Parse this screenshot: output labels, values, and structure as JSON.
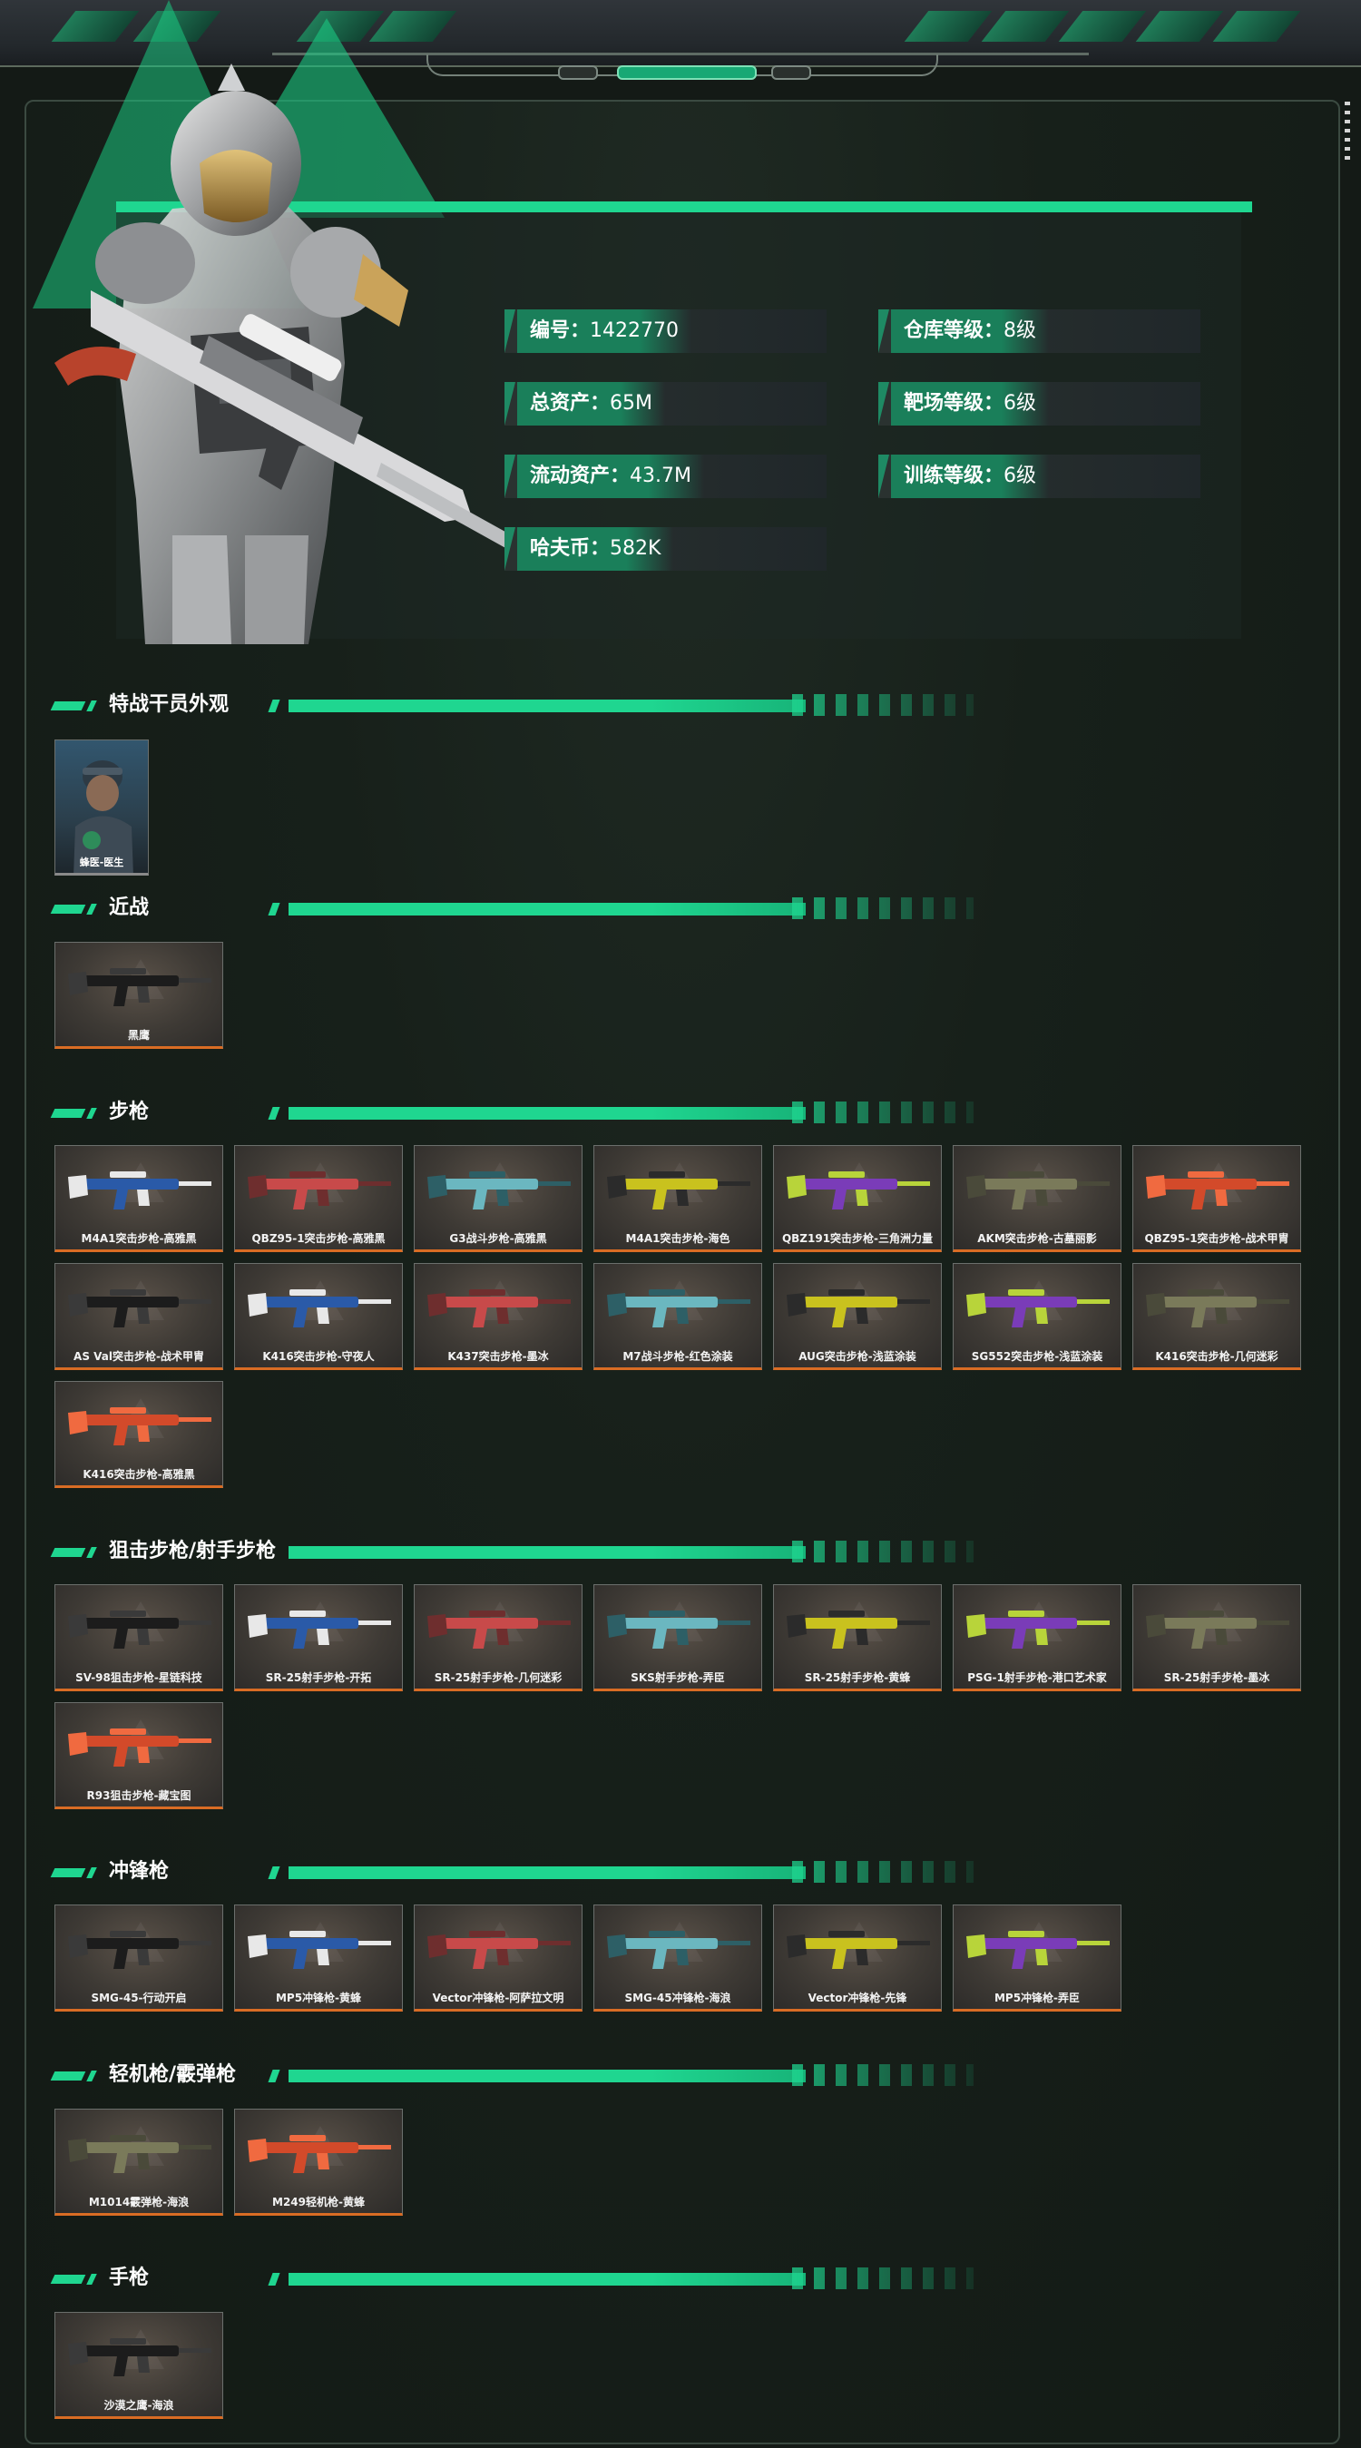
{
  "player": {
    "id_label": "编号：",
    "id_value": "1422770",
    "total_assets_label": "总资产：",
    "total_assets_value": "65M",
    "liquid_assets_label": "流动资产：",
    "liquid_assets_value": "43.7M",
    "havoc_coin_label": "哈夫币：",
    "havoc_coin_value": "582K",
    "warehouse_level_label": "仓库等级：",
    "warehouse_level_value": "8级",
    "range_level_label": "靶场等级：",
    "range_level_value": "6级",
    "training_level_label": "训练等级：",
    "training_level_value": "6级"
  },
  "sections": {
    "operator": {
      "title": "特战干员外观",
      "items": [
        "蜂医-医生"
      ]
    },
    "melee": {
      "title": "近战",
      "items": [
        "黑鹰"
      ]
    },
    "rifle": {
      "title": "步枪",
      "items": [
        "M4A1突击步枪-高雅黑",
        "QBZ95-1突击步枪-高雅黑",
        "G3战斗步枪-高雅黑",
        "M4A1突击步枪-海色",
        "QBZ191突击步枪-三角洲力量",
        "AKM突击步枪-古墓丽影",
        "QBZ95-1突击步枪-战术甲胄",
        "AS Val突击步枪-战术甲胄",
        "K416突击步枪-守夜人",
        "K437突击步枪-墨冰",
        "M7战斗步枪-红色涂装",
        "AUG突击步枪-浅蓝涂装",
        "SG552突击步枪-浅蓝涂装",
        "K416突击步枪-几何迷彩",
        "K416突击步枪-高雅黑"
      ]
    },
    "sniper": {
      "title": "狙击步枪/射手步枪",
      "items": [
        "SV-98狙击步枪-星链科技",
        "SR-25射手步枪-开拓",
        "SR-25射手步枪-几何迷彩",
        "SKS射手步枪-弄臣",
        "SR-25射手步枪-黄蜂",
        "PSG-1射手步枪-港口艺术家",
        "SR-25射手步枪-墨冰",
        "R93狙击步枪-藏宝图"
      ]
    },
    "smg": {
      "title": "冲锋枪",
      "items": [
        "SMG-45-行动开启",
        "MP5冲锋枪-黄蜂",
        "Vector冲锋枪-阿萨拉文明",
        "SMG-45冲锋枪-海浪",
        "Vector冲锋枪-先锋",
        "MP5冲锋枪-弄臣"
      ]
    },
    "lmg": {
      "title": "轻机枪/霰弹枪",
      "items": [
        "M1014霰弹枪-海浪",
        "M249轻机枪-黄蜂"
      ]
    },
    "pistol": {
      "title": "手枪",
      "items": [
        "沙漠之鹰-海浪"
      ]
    }
  },
  "icons": {
    "card_watermark": "triangle-logo-icon",
    "section_marker": "double-slash-icon"
  },
  "colors": {
    "accent": "#1fd690",
    "card_underline": "#d96c24",
    "panel_bg": "#17201a"
  }
}
